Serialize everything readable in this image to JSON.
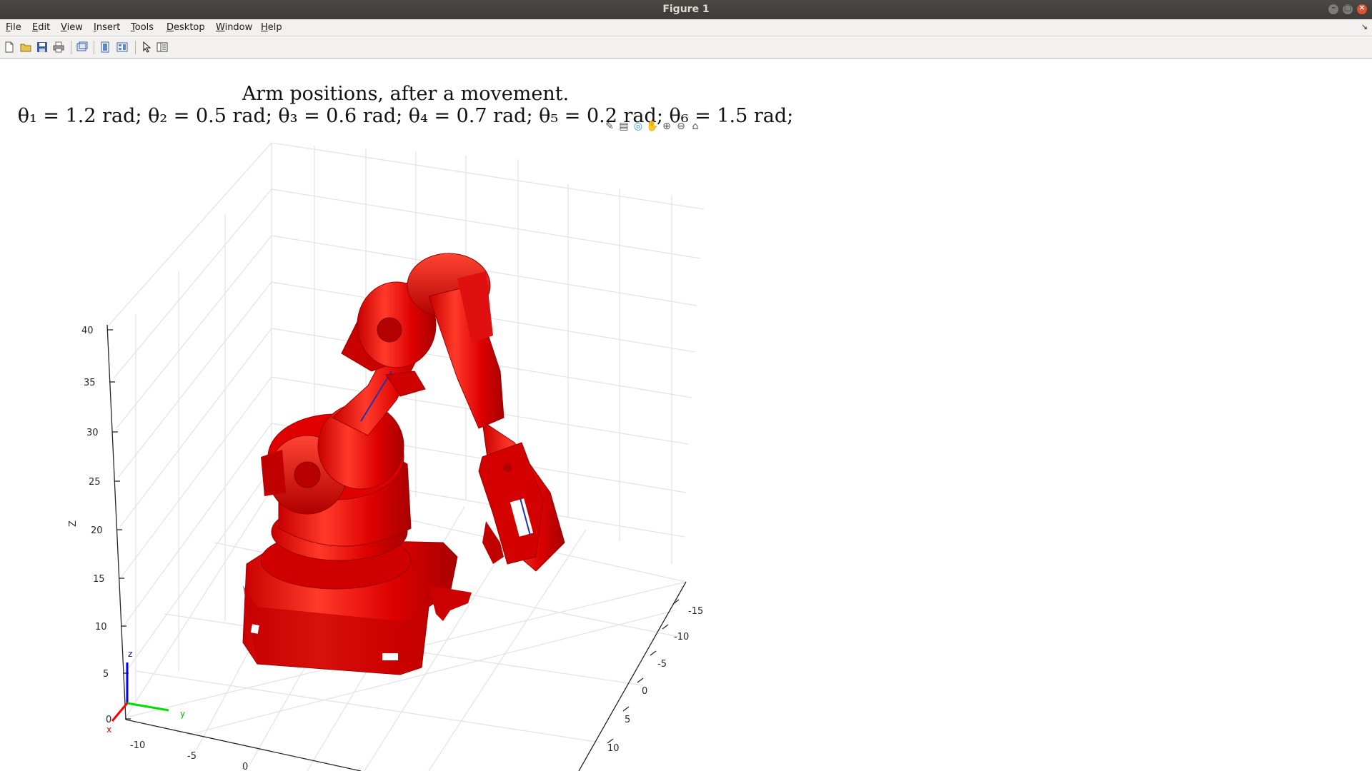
{
  "window": {
    "title": "Figure 1"
  },
  "menu": [
    "File",
    "Edit",
    "View",
    "Insert",
    "Tools",
    "Desktop",
    "Window",
    "Help"
  ],
  "toolbar": {
    "icons": [
      "new-figure-icon",
      "open-file-icon",
      "save-icon",
      "print-icon",
      "link-icon",
      "hide-plot-tools-icon",
      "show-plot-tools-icon",
      "edit-plot-icon",
      "property-inspector-icon"
    ]
  },
  "axes_toolbar": {
    "icons": [
      "brush-icon",
      "data-tips-icon",
      "rotate-3d-icon",
      "pan-icon",
      "zoom-in-icon",
      "zoom-out-icon",
      "restore-view-icon"
    ]
  },
  "figure": {
    "title_line1": "Arm positions, after a movement.",
    "title_line2": "θ₁ = 1.2 rad; θ₂ = 0.5 rad; θ₃ = 0.6 rad; θ₄ = 0.7 rad; θ₅ = 0.2 rad; θ₆ = 1.5 rad;",
    "zlabel": "Z",
    "z_ticks": [
      "0",
      "5",
      "10",
      "15",
      "20",
      "25",
      "30",
      "35",
      "40"
    ],
    "x_ticks": [
      "-10",
      "-5",
      "0"
    ],
    "y_ticks": [
      "-15",
      "-10",
      "-5",
      "0",
      "5",
      "10"
    ],
    "frame_labels": {
      "x": "x",
      "y": "y",
      "z": "z"
    },
    "colors": {
      "robot": "#dd0000",
      "grid": "#e6e6e6",
      "axis": "#262626",
      "x_axis": "#ff0000",
      "y_axis": "#00dd00",
      "z_axis": "#0000ff"
    }
  }
}
